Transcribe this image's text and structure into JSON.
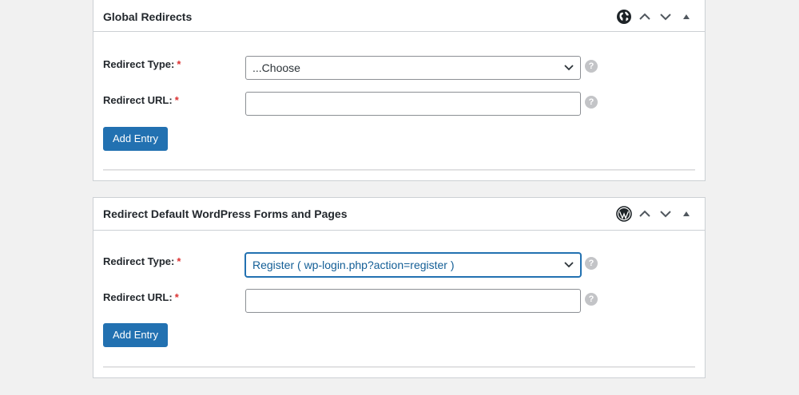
{
  "panels": {
    "global": {
      "title": "Global Redirects",
      "icon": "globe-icon",
      "redirect_type_label": "Redirect Type:",
      "redirect_url_label": "Redirect URL:",
      "required_mark": "*",
      "select_value": "...Choose",
      "url_value": "",
      "help_glyph": "?",
      "add_label": "Add Entry"
    },
    "wordpress": {
      "title": "Redirect Default WordPress Forms and Pages",
      "icon": "wordpress-icon",
      "redirect_type_label": "Redirect Type:",
      "redirect_url_label": "Redirect URL:",
      "required_mark": "*",
      "select_value": "Register ( wp-login.php?action=register )",
      "url_value": "",
      "help_glyph": "?",
      "add_label": "Add Entry"
    }
  },
  "colors": {
    "accent": "#2271b1",
    "required": "#dc3232",
    "background": "#f1f1f1"
  }
}
